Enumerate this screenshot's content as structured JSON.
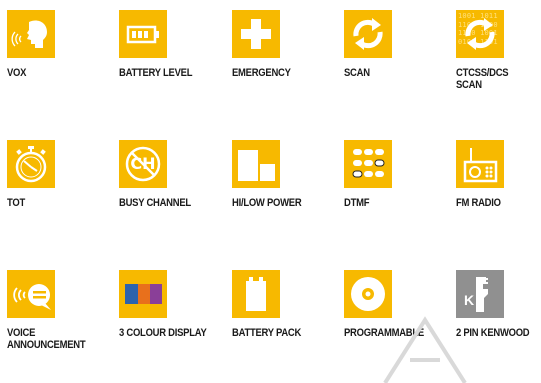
{
  "features": {
    "vox": "VOX",
    "battery_level": "BATTERY LEVEL",
    "emergency": "EMERGENCY",
    "scan": "SCAN",
    "ctcss_dcs_scan": "CTCSS/DCS SCAN",
    "tot": "TOT",
    "busy_channel": "BUSY CHANNEL",
    "hi_low_power": "HI/LOW POWER",
    "dtmf": "DTMF",
    "fm_radio": "FM RADIO",
    "voice_announcement": "VOICE ANNOUNCEMENT",
    "three_colour_display": "3 COLOUR DISPLAY",
    "battery_pack": "BATTERY PACK",
    "programmable": "PROGRAMMABLE",
    "two_pin_kenwood": "2 PIN KENWOOD"
  },
  "icon_glyphs": {
    "binary_code": "1001 1011\n1100 1000\n1100 1001\n0101 1101",
    "ch": "CH",
    "k": "K"
  },
  "colors": {
    "tile": "#f7b900",
    "tile_grey": "#909090",
    "display_blue": "#2c63ad",
    "display_orange": "#e8701c",
    "display_purple": "#8a3f98"
  }
}
